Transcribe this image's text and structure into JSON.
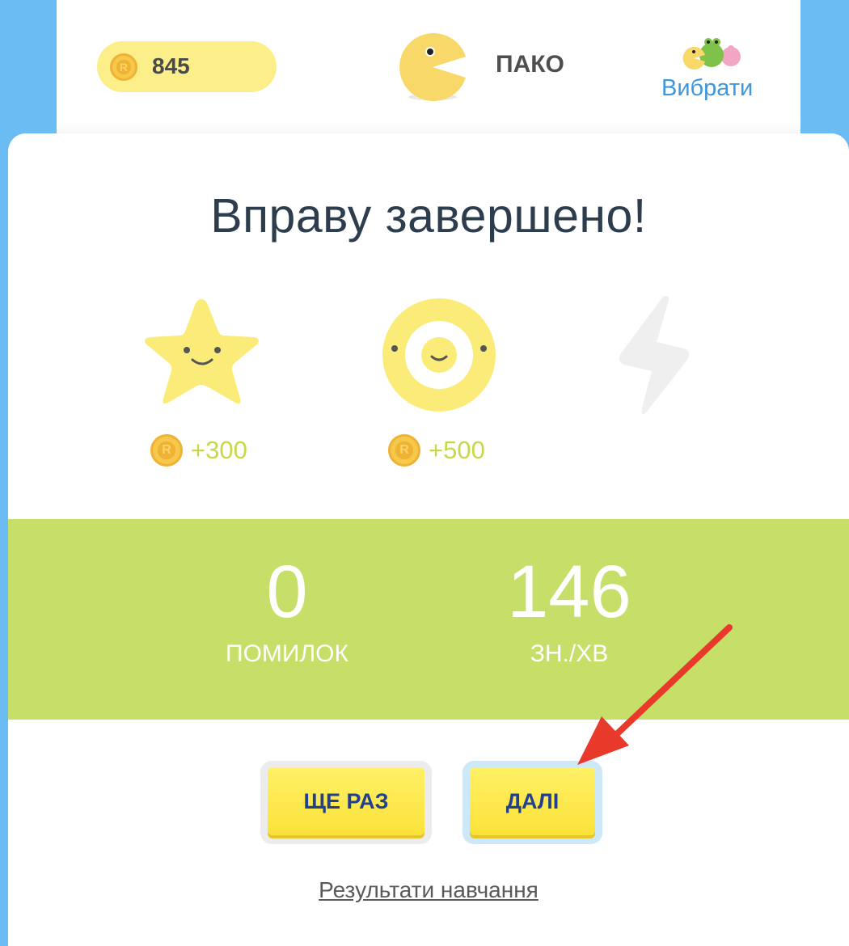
{
  "header": {
    "coins": "845",
    "character_name": "ПАКО",
    "choose_link": "Вибрати"
  },
  "result": {
    "title": "Вправу завершено!",
    "achievements": [
      {
        "icon": "smiling-star-icon",
        "reward": "+300",
        "earned": true
      },
      {
        "icon": "target-ring-icon",
        "reward": "+500",
        "earned": true
      },
      {
        "icon": "lightning-bolt-icon",
        "reward": "",
        "earned": false
      }
    ]
  },
  "stats": {
    "errors_value": "0",
    "errors_label": "ПОМИЛОК",
    "speed_value": "146",
    "speed_label": "ЗН./ХВ"
  },
  "buttons": {
    "retry_label": "ЩЕ РАЗ",
    "next_label": "ДАЛІ"
  },
  "results_link": "Результати навчання",
  "colors": {
    "background": "#6cbcf4",
    "stats_band": "#c6df68",
    "button_yellow": "#fbe23a",
    "button_text": "#23408e",
    "link_blue": "#3e97dc",
    "annotation_arrow": "#e8392b"
  }
}
